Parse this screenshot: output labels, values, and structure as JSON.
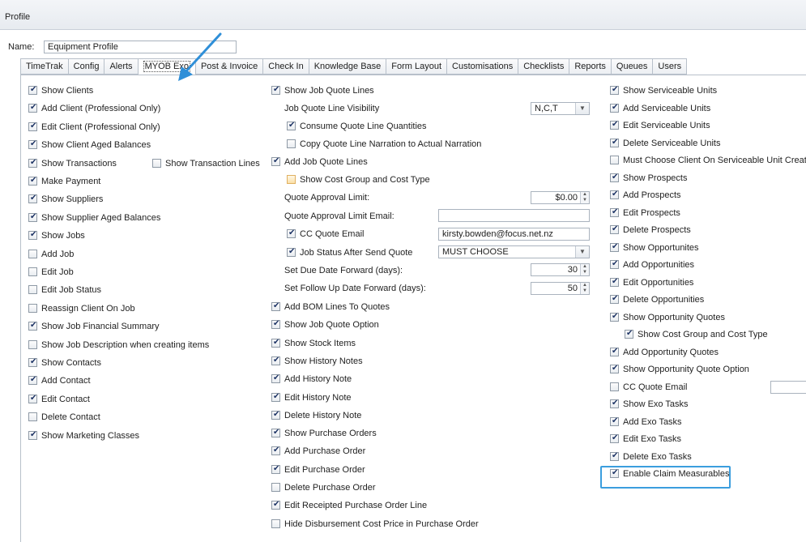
{
  "window": {
    "title": "Profile"
  },
  "name_field": {
    "label": "Name:",
    "value": "Equipment Profile"
  },
  "tabs": [
    "TimeTrak",
    "Config",
    "Alerts",
    "MYOB Exo",
    "Post & Invoice",
    "Check In",
    "Knowledge Base",
    "Form Layout",
    "Customisations",
    "Checklists",
    "Reports",
    "Queues",
    "Users"
  ],
  "active_tab": "MYOB Exo",
  "col1": [
    {
      "label": "Show Clients",
      "checked": true
    },
    {
      "label": "Add Client (Professional Only)",
      "checked": true
    },
    {
      "label": "Edit Client (Professional Only)",
      "checked": true
    },
    {
      "label": "Show Client Aged Balances",
      "checked": true
    },
    {
      "label": "Show Transactions",
      "checked": true
    },
    {
      "label": "Make Payment",
      "checked": true
    },
    {
      "label": "Show Suppliers",
      "checked": true
    },
    {
      "label": "Show Supplier Aged Balances",
      "checked": true
    },
    {
      "label": "Show Jobs",
      "checked": true
    },
    {
      "label": "Add Job",
      "checked": false
    },
    {
      "label": "Edit Job",
      "checked": false
    },
    {
      "label": "Edit Job Status",
      "checked": false
    },
    {
      "label": "Reassign Client On Job",
      "checked": false
    },
    {
      "label": "Show Job Financial Summary",
      "checked": true
    },
    {
      "label": "Show Job Description when creating items",
      "checked": false
    },
    {
      "label": "Show Contacts",
      "checked": true
    },
    {
      "label": "Add Contact",
      "checked": true
    },
    {
      "label": "Edit Contact",
      "checked": true
    },
    {
      "label": "Delete Contact",
      "checked": false
    },
    {
      "label": "Show Marketing Classes",
      "checked": true
    }
  ],
  "col1_extra": {
    "label": "Show Transaction Lines",
    "checked": false
  },
  "col2": {
    "show_job_quote_lines": {
      "label": "Show Job Quote Lines",
      "checked": true
    },
    "visibility": {
      "label": "Job Quote Line Visibility",
      "value": "N,C,T"
    },
    "consume": {
      "label": "Consume Quote Line Quantities",
      "checked": true
    },
    "copy_narration": {
      "label": "Copy Quote Line Narration to Actual Narration",
      "checked": false
    },
    "add_job_quote_lines": {
      "label": "Add Job Quote Lines",
      "checked": true
    },
    "show_cost_group": {
      "label": "Show Cost Group and Cost Type",
      "checked": false
    },
    "approval_limit": {
      "label": "Quote Approval Limit:",
      "value": "$0.00"
    },
    "approval_email": {
      "label": "Quote Approval Limit Email:",
      "value": ""
    },
    "cc_quote_email": {
      "label": "CC Quote Email",
      "checked": true,
      "value": "kirsty.bowden@focus.net.nz"
    },
    "job_status": {
      "label": "Job Status After Send Quote",
      "checked": true,
      "value": "MUST CHOOSE"
    },
    "due_date": {
      "label": "Set Due Date Forward (days):",
      "value": "30"
    },
    "follow_up": {
      "label": "Set Follow Up Date Forward (days):",
      "value": "50"
    },
    "rest": [
      {
        "label": "Add BOM Lines To Quotes",
        "checked": true
      },
      {
        "label": "Show Job Quote Option",
        "checked": true
      },
      {
        "label": "Show Stock Items",
        "checked": true
      },
      {
        "label": "Show History Notes",
        "checked": true
      },
      {
        "label": "Add History Note",
        "checked": true
      },
      {
        "label": "Edit History Note",
        "checked": true
      },
      {
        "label": "Delete History Note",
        "checked": true
      },
      {
        "label": "Show Purchase Orders",
        "checked": true
      },
      {
        "label": "Add Purchase Order",
        "checked": true
      },
      {
        "label": "Edit Purchase Order",
        "checked": true
      },
      {
        "label": "Delete Purchase Order",
        "checked": false
      },
      {
        "label": "Edit Receipted Purchase Order Line",
        "checked": true
      },
      {
        "label": "Hide Disbursement Cost Price in Purchase Order",
        "checked": false
      }
    ]
  },
  "col3": [
    {
      "label": "Show Serviceable Units",
      "checked": true
    },
    {
      "label": "Add Serviceable Units",
      "checked": true
    },
    {
      "label": "Edit Serviceable Units",
      "checked": true
    },
    {
      "label": "Delete Serviceable Units",
      "checked": true
    },
    {
      "label": "Must Choose Client On Serviceable Unit Creation",
      "checked": false
    },
    {
      "label": "Show Prospects",
      "checked": true
    },
    {
      "label": "Add Prospects",
      "checked": true
    },
    {
      "label": "Edit Prospects",
      "checked": true
    },
    {
      "label": "Delete Prospects",
      "checked": true
    },
    {
      "label": "Show Opportunites",
      "checked": true
    },
    {
      "label": "Add Opportunities",
      "checked": true
    },
    {
      "label": "Edit Opportunities",
      "checked": true
    },
    {
      "label": "Delete Opportunities",
      "checked": true
    },
    {
      "label": "Show Opportunity Quotes",
      "checked": true
    },
    {
      "label": "Show Cost Group and Cost Type",
      "checked": true,
      "indent": true
    },
    {
      "label": "Add Opportunity Quotes",
      "checked": true
    },
    {
      "label": "Show Opportunity Quote Option",
      "checked": true
    },
    {
      "label": "CC Quote Email",
      "checked": false
    },
    {
      "label": "Show Exo Tasks",
      "checked": true
    },
    {
      "label": "Add Exo Tasks",
      "checked": true
    },
    {
      "label": "Edit Exo Tasks",
      "checked": true
    },
    {
      "label": "Delete Exo Tasks",
      "checked": true
    },
    {
      "label": "Enable Claim Measurables",
      "checked": true
    }
  ],
  "colors": {
    "highlight": "#3b9ede",
    "arrow": "#2f8fd8"
  }
}
